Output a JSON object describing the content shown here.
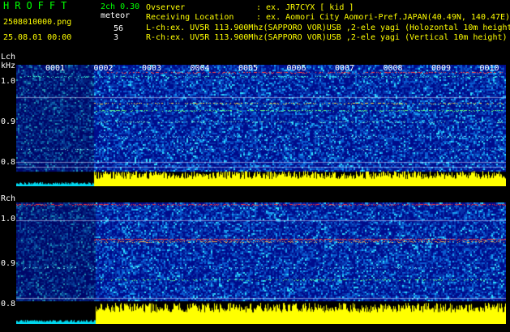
{
  "header": {
    "brand": "HROFFT",
    "mode": "2ch 0.30",
    "mode_sub": "meteor",
    "filename": "2508010000.png",
    "datetime": "25.08.01 00:00",
    "count_l": "56",
    "count_r": "3",
    "observer_label": "Ovserver",
    "observer_value": ": ex. JR7CYX [ kid ]",
    "location_label": "Receiving Location",
    "location_value": ": ex. Aomori City Aomori-Pref.JAPAN(40.49N, 140.47E)",
    "lch_line": "L-ch:ex. UV5R 113.900Mhz(SAPPORO VOR)USB ,2-ele yagi (Holozontal 10m height)",
    "rch_line": "R-ch:ex. UV5R 113.900Mhz(SAPPORO VOR)USB ,2-ele yagi (Vertical 10m height)"
  },
  "lch": {
    "label": "Lch",
    "unit": "kHz",
    "ticks": [
      "1.0",
      "0.9",
      "0.8"
    ]
  },
  "rch": {
    "label": "Rch",
    "ticks": [
      "1.0",
      "0.9",
      "0.8"
    ]
  },
  "minutes": [
    "0001",
    "0002",
    "0003",
    "0004",
    "0005",
    "0006",
    "0007",
    "0008",
    "0009",
    "0010"
  ],
  "colors": {
    "spectrum_dark": "#000c8c",
    "spectrum_mid": "#0050d8",
    "spectrum_cyan": "#00d8f0",
    "meteor_red": "#ff3030",
    "bar_yellow": "#ffff00",
    "header_green": "#00ff00",
    "header_yellow": "#ffff00"
  }
}
